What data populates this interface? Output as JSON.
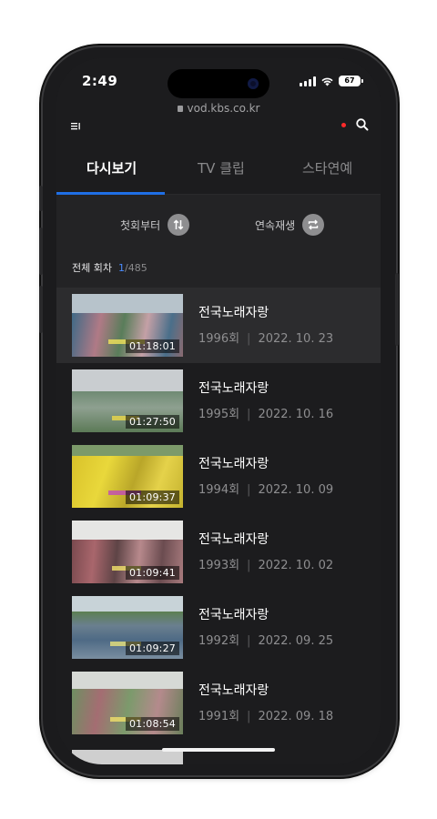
{
  "status_bar": {
    "time": "2:49",
    "battery": "67"
  },
  "browser": {
    "url": "vod.kbs.co.kr"
  },
  "tabs": [
    {
      "label": "다시보기",
      "active": true
    },
    {
      "label": "TV 클립",
      "active": false
    },
    {
      "label": "스타연예",
      "active": false
    }
  ],
  "controls": {
    "first_label": "첫회부터",
    "autoplay_label": "연속재생"
  },
  "episode_count": {
    "label": "전체 회차",
    "current": "1",
    "total": "/485"
  },
  "episodes": [
    {
      "title": "전국노래자랑",
      "episode": "1996회",
      "date": "2022. 10. 23",
      "duration": "01:18:01"
    },
    {
      "title": "전국노래자랑",
      "episode": "1995회",
      "date": "2022. 10. 16",
      "duration": "01:27:50"
    },
    {
      "title": "전국노래자랑",
      "episode": "1994회",
      "date": "2022. 10. 09",
      "duration": "01:09:37"
    },
    {
      "title": "전국노래자랑",
      "episode": "1993회",
      "date": "2022. 10. 02",
      "duration": "01:09:41"
    },
    {
      "title": "전국노래자랑",
      "episode": "1992회",
      "date": "2022. 09. 25",
      "duration": "01:09:27"
    },
    {
      "title": "전국노래자랑",
      "episode": "1991회",
      "date": "2022. 09. 18",
      "duration": "01:08:54"
    }
  ],
  "meta_separator": "|",
  "colors": {
    "accent": "#1f6fe5",
    "background": "#1c1c1e",
    "notification": "#ff2a2a"
  }
}
